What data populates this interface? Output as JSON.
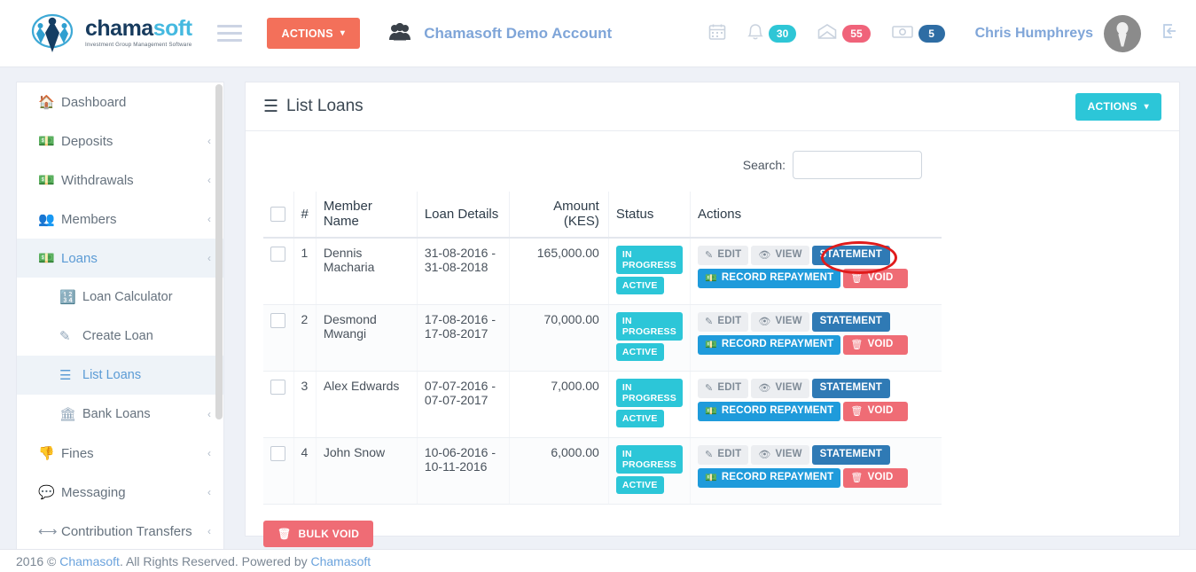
{
  "header": {
    "logo": {
      "word_dark": "chama",
      "word_light": "soft",
      "tagline": "Investment Group Management Software"
    },
    "actions_button": "ACTIONS",
    "account_name": "Chamasoft Demo Account",
    "badges": {
      "bell": "30",
      "mail": "55",
      "money": "5"
    },
    "user_name": "Chris Humphreys"
  },
  "sidebar": {
    "items": [
      {
        "label": "Dashboard",
        "icon": "home-icon",
        "arrow": ""
      },
      {
        "label": "Deposits",
        "icon": "money-icon",
        "arrow": "‹"
      },
      {
        "label": "Withdrawals",
        "icon": "money-icon",
        "arrow": "‹"
      },
      {
        "label": "Members",
        "icon": "users-icon",
        "arrow": "‹"
      },
      {
        "label": "Loans",
        "icon": "money-icon",
        "arrow": "‹"
      },
      {
        "label": "Loan Calculator",
        "icon": "calculator-icon",
        "arrow": ""
      },
      {
        "label": "Create Loan",
        "icon": "pencil-icon",
        "arrow": ""
      },
      {
        "label": "List Loans",
        "icon": "list-icon",
        "arrow": ""
      },
      {
        "label": "Bank Loans",
        "icon": "bank-icon",
        "arrow": "‹"
      },
      {
        "label": "Fines",
        "icon": "thumbs-down-icon",
        "arrow": "‹"
      },
      {
        "label": "Messaging",
        "icon": "chat-icon",
        "arrow": "‹"
      },
      {
        "label": "Contribution Transfers",
        "icon": "arrows-icon",
        "arrow": "‹"
      }
    ]
  },
  "panel": {
    "title": "List Loans",
    "actions_button": "ACTIONS",
    "search_label": "Search:",
    "search_value": "",
    "search_placeholder": "",
    "bulk_void_label": "BULK VOID"
  },
  "table": {
    "headers": [
      "",
      "#",
      "Member Name",
      "Loan Details",
      "Amount (KES)",
      "Status",
      "Actions"
    ],
    "action_labels": {
      "edit": "EDIT",
      "view": "VIEW",
      "statement": "STATEMENT",
      "record": "RECORD REPAYMENT",
      "void": "VOID"
    },
    "rows": [
      {
        "num": "1",
        "name": "Dennis Macharia",
        "details": "31-08-2016 - 31-08-2018",
        "amount": "165,000.00",
        "status_1": "IN PROGRESS",
        "status_2": "ACTIVE"
      },
      {
        "num": "2",
        "name": "Desmond Mwangi",
        "details": "17-08-2016 - 17-08-2017",
        "amount": "70,000.00",
        "status_1": "IN PROGRESS",
        "status_2": "ACTIVE"
      },
      {
        "num": "3",
        "name": "Alex Edwards",
        "details": "07-07-2016 - 07-07-2017",
        "amount": "7,000.00",
        "status_1": "IN PROGRESS",
        "status_2": "ACTIVE"
      },
      {
        "num": "4",
        "name": "John Snow",
        "details": "10-06-2016 - 10-11-2016",
        "amount": "6,000.00",
        "status_1": "IN PROGRESS",
        "status_2": "ACTIVE"
      }
    ]
  },
  "footer": {
    "text_before": "2016 © ",
    "link1": "Chamasoft",
    "text_mid": ". All Rights Reserved. Powered by ",
    "link2": "Chamasoft"
  },
  "colors": {
    "accent_coral": "#f3705a",
    "accent_teal": "#2cc6d8",
    "badge_red": "#f0637a",
    "badge_blue": "#2e6da4",
    "void_red": "#ef6c75",
    "statement_blue": "#2f7ab5",
    "record_blue": "#1f9bdb",
    "annotation_red": "#e01b1b"
  }
}
